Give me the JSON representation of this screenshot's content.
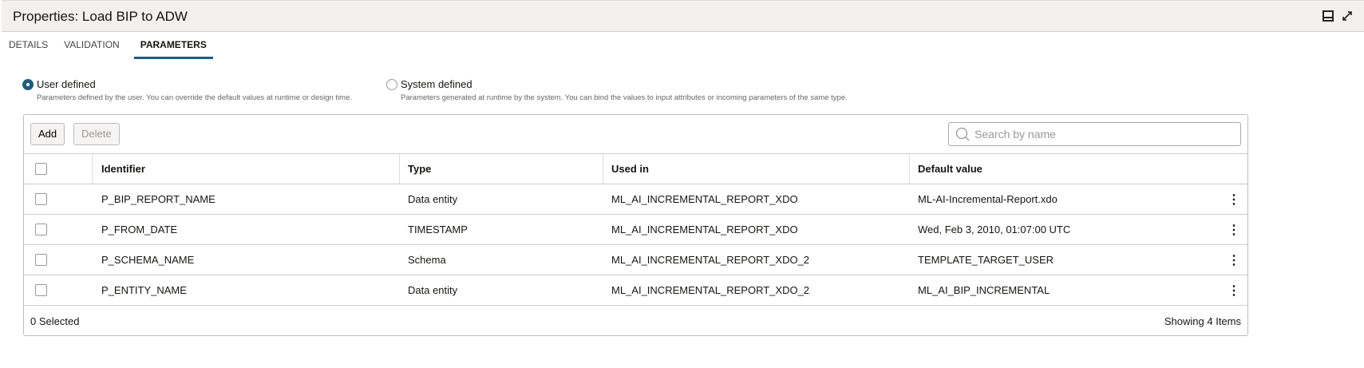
{
  "header": {
    "title": "Properties: Load BIP to ADW"
  },
  "tabs": [
    {
      "label": "DETAILS"
    },
    {
      "label": "VALIDATION"
    },
    {
      "label": "PARAMETERS"
    }
  ],
  "radios": [
    {
      "label": "User defined",
      "description": "Parameters defined by the user. You can override the default values at runtime or design time.",
      "selected": true
    },
    {
      "label": "System defined",
      "description": "Parameters generated at runtime by the system. You can bind the values to input attributes or incoming parameters of the same type.",
      "selected": false
    }
  ],
  "toolbar": {
    "add": "Add",
    "delete": "Delete",
    "search_placeholder": "Search by name"
  },
  "table": {
    "columns": [
      "Identifier",
      "Type",
      "Used in",
      "Default value"
    ],
    "rows": [
      [
        "P_BIP_REPORT_NAME",
        "Data entity",
        "ML_AI_INCREMENTAL_REPORT_XDO",
        "ML-AI-Incremental-Report.xdo"
      ],
      [
        "P_FROM_DATE",
        "TIMESTAMP",
        "ML_AI_INCREMENTAL_REPORT_XDO",
        "Wed, Feb 3, 2010, 01:07:00 UTC"
      ],
      [
        "P_SCHEMA_NAME",
        "Schema",
        "ML_AI_INCREMENTAL_REPORT_XDO_2",
        "TEMPLATE_TARGET_USER"
      ],
      [
        "P_ENTITY_NAME",
        "Data entity",
        "ML_AI_INCREMENTAL_REPORT_XDO_2",
        "ML_AI_BIP_INCREMENTAL"
      ]
    ]
  },
  "footer": {
    "selected": "0 Selected",
    "showing": "Showing 4 Items"
  }
}
